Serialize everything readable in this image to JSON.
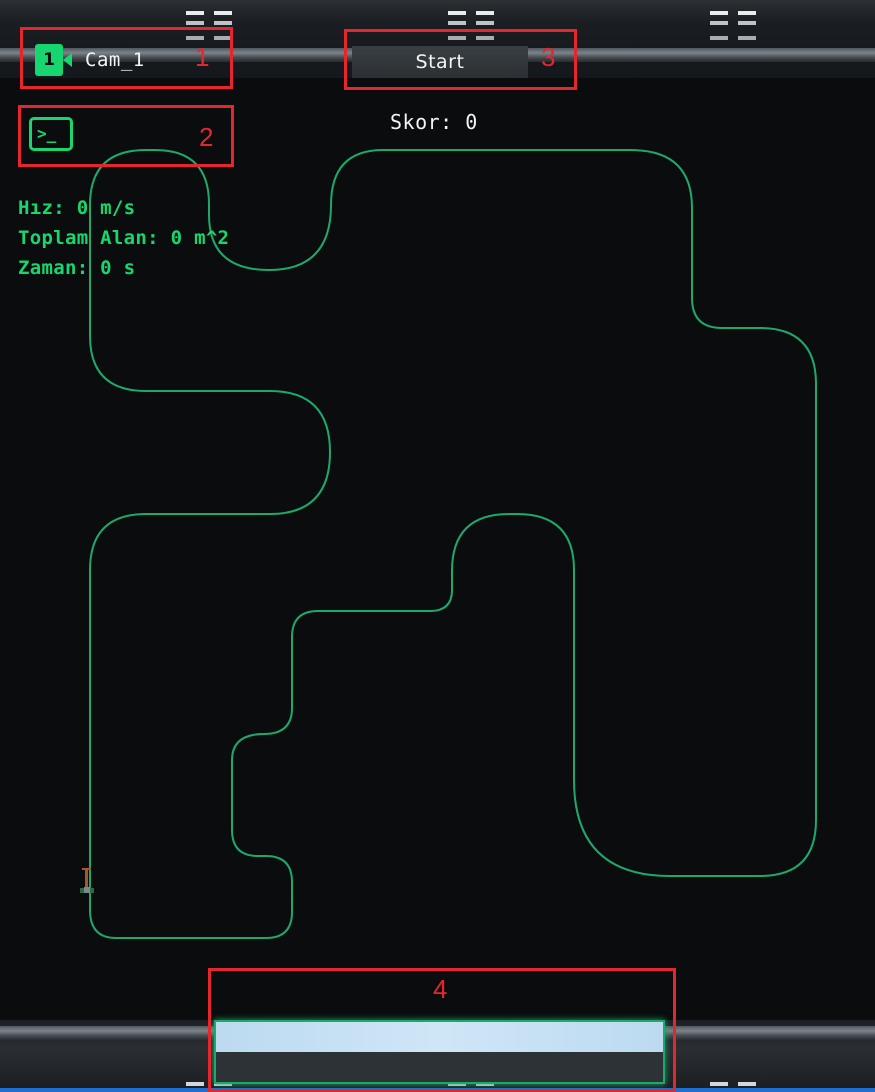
{
  "camera": {
    "badge": "1",
    "label": "Cam_1"
  },
  "console": {
    "prompt": ">_",
    "icon": "terminal-icon"
  },
  "start": {
    "label": "Start"
  },
  "score": {
    "text": "Skor: 0"
  },
  "stats": {
    "speed": "Hız: 0 m/s",
    "area": "Toplam Alan: 0 m^2",
    "time": "Zaman: 0 s"
  },
  "progress": {
    "fraction": 1.0
  },
  "annotations": [
    "1",
    "2",
    "3",
    "4"
  ],
  "colors": {
    "accent": "#18d66f",
    "track": "#1ea86a",
    "annotation": "#e5262c",
    "progress_fill": "#c5e0f4"
  }
}
